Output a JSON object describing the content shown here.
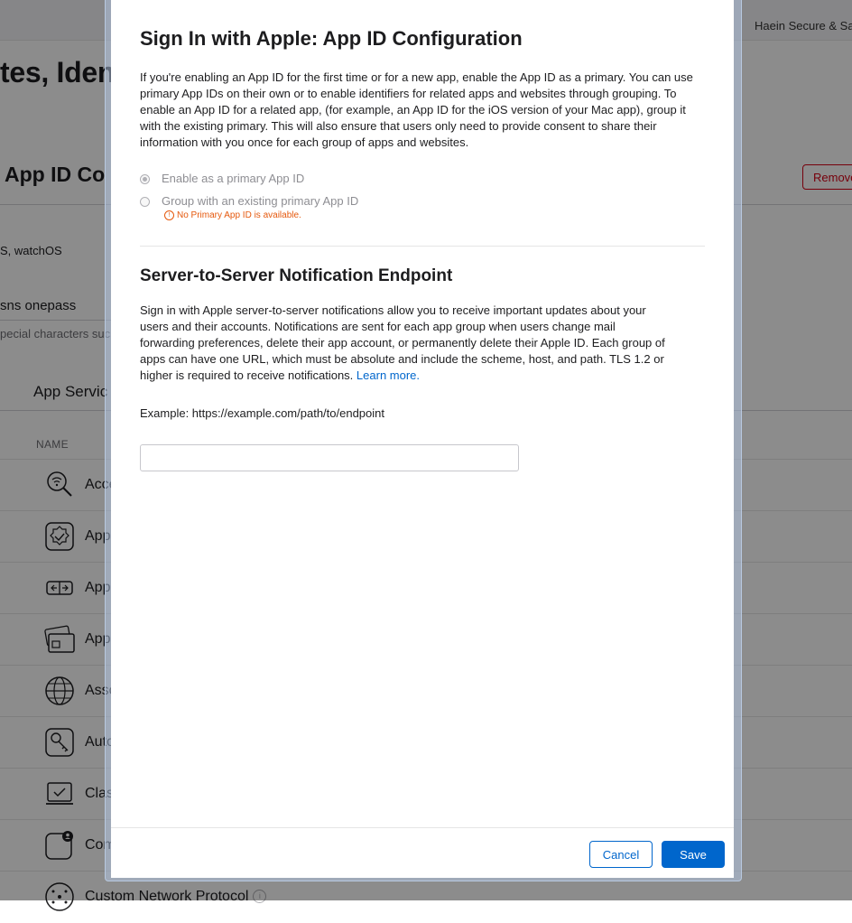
{
  "header": {
    "team_name": "Haein Secure & Sa"
  },
  "page": {
    "title": "tes, Iden",
    "section_title": "App ID Co",
    "remove_label": "Remove",
    "platforms": "S, watchOS",
    "description_value": "sns onepass",
    "description_hint": "pecial characters suc",
    "services_tab": "App Servic",
    "name_column": "NAME",
    "capabilities": [
      {
        "label": "Acce",
        "icon": "wifi-search-icon"
      },
      {
        "label": "Appe",
        "icon": "badge-check-icon"
      },
      {
        "label": "Appe",
        "icon": "app-groups-icon"
      },
      {
        "label": "Appe",
        "icon": "wallet-card-icon"
      },
      {
        "label": "Asso",
        "icon": "globe-icon"
      },
      {
        "label": "Auto",
        "icon": "autofill-key-icon"
      },
      {
        "label": "Clas",
        "icon": "classkit-icon"
      },
      {
        "label": "Com",
        "icon": "communication-icon"
      },
      {
        "label": "Custom Network Protocol",
        "icon": "network-protocol-icon"
      }
    ]
  },
  "modal": {
    "title": "Sign In with Apple: App ID Configuration",
    "intro": "If you're enabling an App ID for the first time or for a new app, enable the App ID as a primary. You can use primary App IDs on their own or to enable identifiers for related apps and websites through grouping. To enable an App ID for a related app, (for example, an App ID for the iOS version of your Mac app), group it with the existing primary. This will also ensure that users only need to provide consent to share their information with you once for each group of apps and websites.",
    "option_primary": "Enable as a primary App ID",
    "option_group": "Group with an existing primary App ID",
    "warning": "No Primary App ID is available.",
    "server_title": "Server-to-Server Notification Endpoint",
    "server_text": "Sign in with Apple server-to-server notifications allow you to receive important updates about your users and their accounts. Notifications are sent for each app group when users change mail forwarding preferences, delete their app account, or permanently delete their Apple ID. Each group of apps can have one URL, which must be absolute and include the scheme, host, and path. TLS 1.2 or higher is required to receive notifications.",
    "learn_more": "Learn more.",
    "example": "Example: https://example.com/path/to/endpoint",
    "endpoint_value": "",
    "cancel_label": "Cancel",
    "save_label": "Save"
  },
  "colors": {
    "accent": "#0066cc",
    "warning": "#e5580c",
    "danger": "#d70015"
  }
}
